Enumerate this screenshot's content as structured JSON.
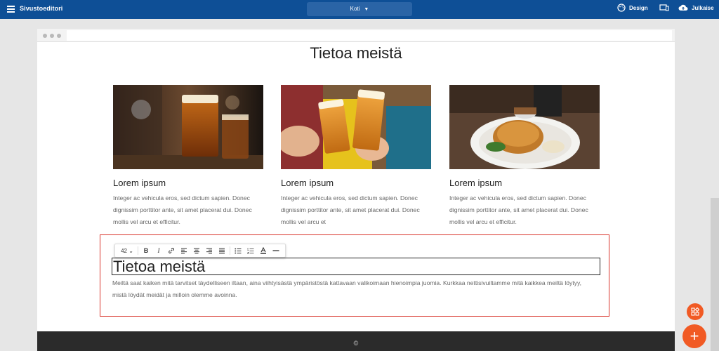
{
  "topbar": {
    "app_title": "Sivustoeditori",
    "page_select": "Koti",
    "design_label": "Design",
    "publish_label": "Julkaise"
  },
  "section": {
    "title": "Tietoa meistä"
  },
  "cards": [
    {
      "title": "Lorem ipsum",
      "text": "Integer ac vehicula eros, sed dictum sapien. Donec dignissim porttitor ante, sit amet placerat dui. Donec mollis vel arcu et efficitur."
    },
    {
      "title": "Lorem ipsum",
      "text": "Integer ac vehicula eros, sed dictum sapien. Donec dignissim porttitor ante, sit amet placerat dui. Donec mollis vel arcu et"
    },
    {
      "title": "Lorem ipsum",
      "text": "Integer ac vehicula eros, sed dictum sapien. Donec dignissim porttitor ante, sit amet placerat dui. Donec mollis vel arcu et efficitur."
    }
  ],
  "toolbar": {
    "font_size": "42"
  },
  "editor": {
    "heading": "Tietoa meistä",
    "body": "Meiltä saat kaiken mitä tarvitset täydelliseen iltaan, aina viihtyisästä ympäristöstä kattavaan valikoimaan hienoimpia juomia. Kurkkaa nettisivuiltamme mitä kaikkea meiltä löytyy, mistä löydät meidät ja milloin olemme avoinna."
  },
  "footer": {
    "text": "©"
  },
  "colors": {
    "topbar": "#0e4f96",
    "accent": "#f15a24",
    "selection": "#d9342b"
  }
}
